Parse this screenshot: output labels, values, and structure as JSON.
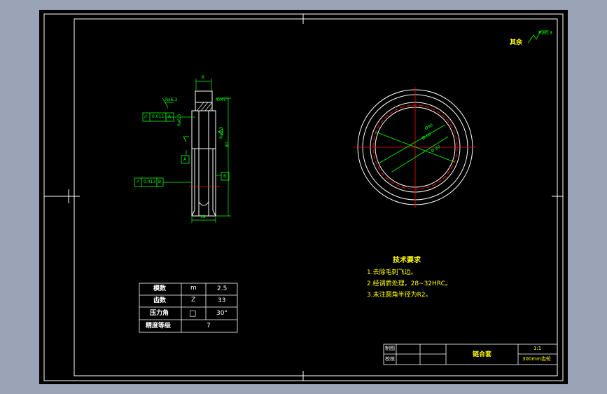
{
  "drawing": {
    "surface_finish_top_right": {
      "prefix": "其余",
      "value": "Ra6.3"
    },
    "tech_requirements": {
      "title": "技术要求",
      "items": [
        "1.去除毛刺飞边。",
        "2.经调质处理，28~32HRC。",
        "3.未注圆角半径为R2。"
      ]
    },
    "params_table": {
      "rows": [
        {
          "name": "模数",
          "symbol": "m",
          "value": "2.5"
        },
        {
          "name": "齿数",
          "symbol": "Z",
          "value": "33"
        },
        {
          "name": "压力角",
          "symbol": "□",
          "value": "30°"
        },
        {
          "name": "精度等级",
          "symbol": "",
          "value": "7"
        }
      ]
    },
    "title_block": {
      "drawn_label": "制图",
      "checked_label": "校核",
      "part_name": "链合套",
      "scale": "1:1",
      "code": "300mm齿轮"
    },
    "side_view": {
      "roughness_1": "Ra6.3",
      "roughness_2": "Ra6.3",
      "tolerance_1": {
        "symbol": "//",
        "value": "0.015",
        "datum": "A"
      },
      "tolerance_2": {
        "symbol": "↗",
        "value": "0.013",
        "datum": "B"
      },
      "datum_a": "A",
      "datum_b": "B",
      "dim_top": "8",
      "dim_chamfer": "4x45°",
      "dim_height": "80",
      "dim_width": "18"
    },
    "front_view": {
      "dia_1": "Ø90",
      "dia_2": "Ø 60",
      "dia_3": "Ø 80"
    }
  },
  "colors": {
    "background": "#000000",
    "frame": "#ffffff",
    "geometry": "#00ff00",
    "center_line": "#ff0000",
    "text": "#ffff00"
  }
}
